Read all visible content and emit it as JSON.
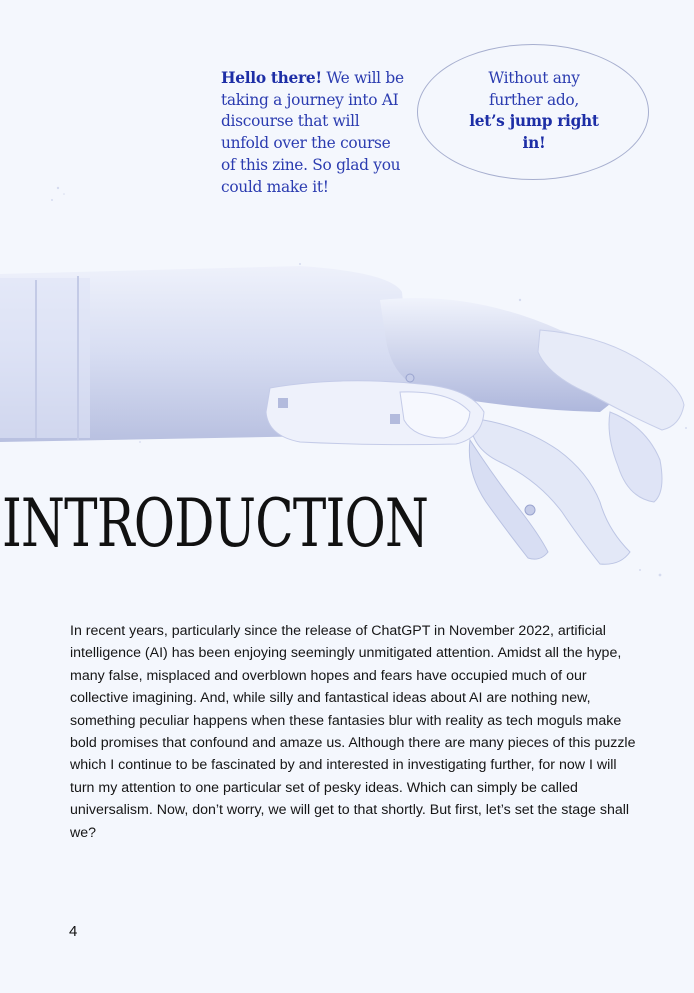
{
  "intro_speech": {
    "bold": "Hello there!",
    "rest": " We will be taking a journey into AI discourse that will unfold over the course of this zine. So glad you could make it!"
  },
  "bubble": {
    "line1": "Without any further ado,",
    "bold": "let’s jump right in!"
  },
  "heading": "INTRODUCTION",
  "body_paragraph": "In recent years, particularly since the release of ChatGPT in November 2022, artificial intelligence (AI) has been enjoying seemingly unmitigated attention. Amidst all the hype, many false, misplaced and overblown hopes and fears have occupied much of our collective imagining. And, while silly and fantastical ideas about AI are nothing new, something peculiar happens when these fantasies blur with reality as tech moguls make bold promises that confound and amaze us. Although there are many pieces of this puzzle which I continue to be fascinated by and interested in investigating further, for now I will turn my attention to one particular set of pesky ideas. Which can simply be called universalism. Now, don’t worry, we will get to that shortly. But first, let’s set the stage shall we?",
  "page_number": "4",
  "colors": {
    "accent_blue": "#2b3cb0",
    "background": "#f4f7fd",
    "text": "#161616"
  },
  "image": "robotic-hand"
}
